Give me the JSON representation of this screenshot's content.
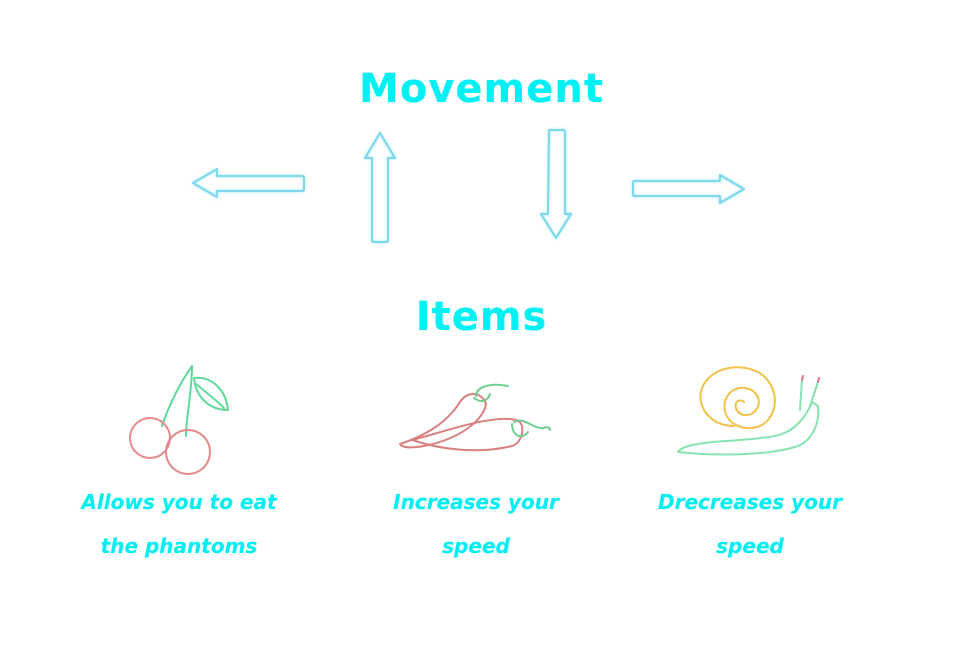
{
  "headings": {
    "movement": "Movement",
    "items": "Items"
  },
  "movement": {
    "arrows": [
      {
        "direction": "left",
        "icon": "arrow-left-icon"
      },
      {
        "direction": "up",
        "icon": "arrow-up-icon"
      },
      {
        "direction": "down",
        "icon": "arrow-down-icon"
      },
      {
        "direction": "right",
        "icon": "arrow-right-icon"
      }
    ]
  },
  "items": [
    {
      "icon": "cherry-icon",
      "line1": "Allows you to eat",
      "line2": "the phantoms"
    },
    {
      "icon": "chili-pepper-icon",
      "line1": "Increases your",
      "line2": "speed"
    },
    {
      "icon": "snail-icon",
      "line1": "Drecreases your",
      "line2": "speed"
    }
  ],
  "colors": {
    "heading": "#00f0f4",
    "caption": "#00eef2",
    "arrow_stroke": "#7fd8ec",
    "cherry_fruit": "#e58a8f",
    "cherry_stem": "#5fd99a",
    "pepper_body": "#d98080",
    "pepper_stem": "#6fce8f",
    "snail_shell": "#f5c04a",
    "snail_body": "#88e3b0",
    "snail_antenna_tip": "#ee6b87"
  }
}
